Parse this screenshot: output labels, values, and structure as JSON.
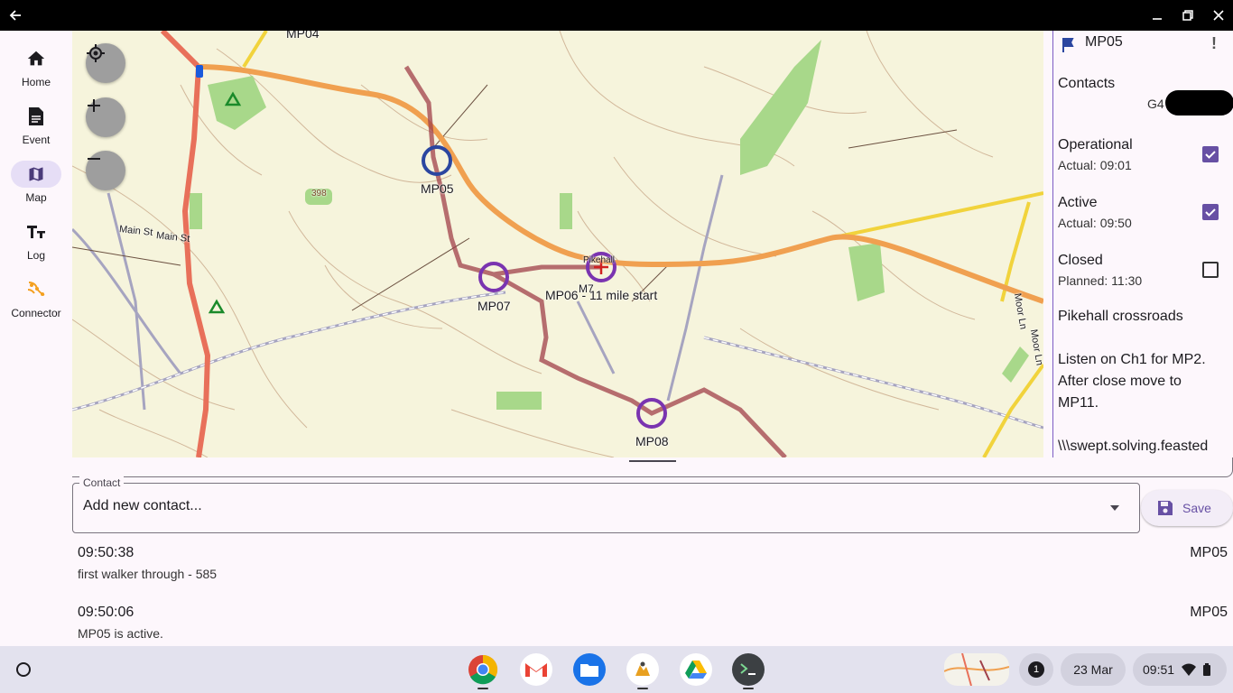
{
  "window": {
    "back": "back",
    "minimize": "minimize",
    "maximize": "maximize",
    "close": "close"
  },
  "rail": {
    "items": [
      {
        "label": "Home",
        "icon": "home-icon"
      },
      {
        "label": "Event",
        "icon": "document-icon"
      },
      {
        "label": "Map",
        "icon": "map-icon",
        "active": true
      },
      {
        "label": "Log",
        "icon": "text-icon"
      },
      {
        "label": "Connector",
        "icon": "connector-icon"
      }
    ]
  },
  "map": {
    "labels": {
      "mp04": "MP04",
      "mp05": "MP05",
      "mp07": "MP07",
      "mp06": "MP06 - 11 mile start",
      "mp08": "MP08",
      "road1": "Main St",
      "road2": "Main St",
      "road3": "Moor Ln",
      "road4": "Moor Ln",
      "spot": "398",
      "place": "Pikehall",
      "m7": "M7"
    }
  },
  "panel": {
    "title": "MP05",
    "contacts_label": "Contacts",
    "contact_value": "G4",
    "operational": {
      "label": "Operational",
      "sub": "Actual: 09:01",
      "checked": true
    },
    "active": {
      "label": "Active",
      "sub": "Actual: 09:50",
      "checked": true
    },
    "closed": {
      "label": "Closed",
      "sub": "Planned: 11:30",
      "checked": false
    },
    "location": "Pikehall crossroads",
    "note_line1": "Listen on Ch1 for MP2.",
    "note_line2": "After close move to",
    "note_line3": "MP11.",
    "w3w": "\\\\\\swept.solving.feasted"
  },
  "contact": {
    "legend": "Contact",
    "placeholder": "Add new contact...",
    "save_label": "Save"
  },
  "log": [
    {
      "time": "09:50:38",
      "message": "first walker through - 585",
      "mp": "MP05"
    },
    {
      "time": "09:50:06",
      "message": "MP05 is active.",
      "mp": "MP05"
    }
  ],
  "shelf": {
    "notification_count": "1",
    "date": "23 Mar",
    "time": "09:51"
  }
}
